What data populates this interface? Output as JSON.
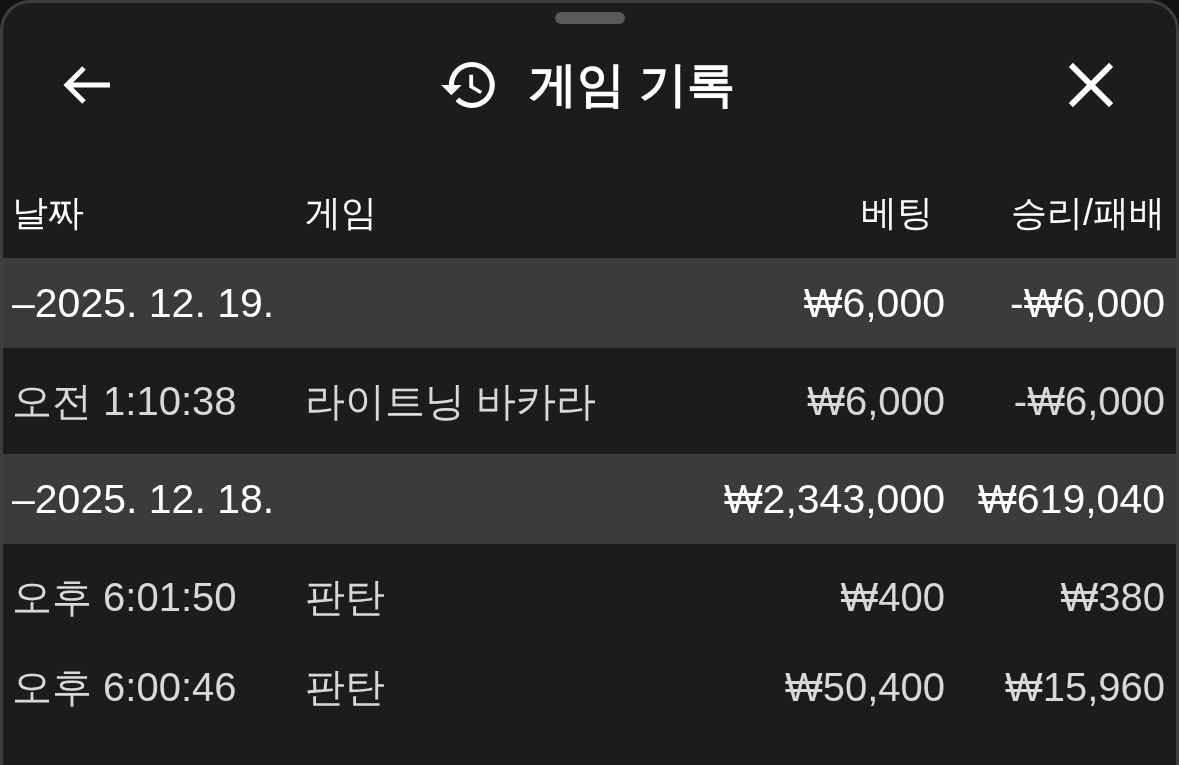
{
  "header": {
    "title": "게임 기록"
  },
  "columns": [
    "날짜",
    "게임",
    "베팅",
    "승리/패배"
  ],
  "groups": [
    {
      "date": "–2025. 12. 19.",
      "bet": "₩6,000",
      "result": "-₩6,000",
      "rows": [
        {
          "time": "오전 1:10:38",
          "game": "라이트닝 바카라",
          "bet": "₩6,000",
          "result": "-₩6,000"
        }
      ]
    },
    {
      "date": "–2025. 12. 18.",
      "bet": "₩2,343,000",
      "result": "₩619,040",
      "rows": [
        {
          "time": "오후 6:01:50",
          "game": "판탄",
          "bet": "₩400",
          "result": "₩380"
        },
        {
          "time": "오후 6:00:46",
          "game": "판탄",
          "bet": "₩50,400",
          "result": "₩15,960"
        }
      ]
    }
  ]
}
